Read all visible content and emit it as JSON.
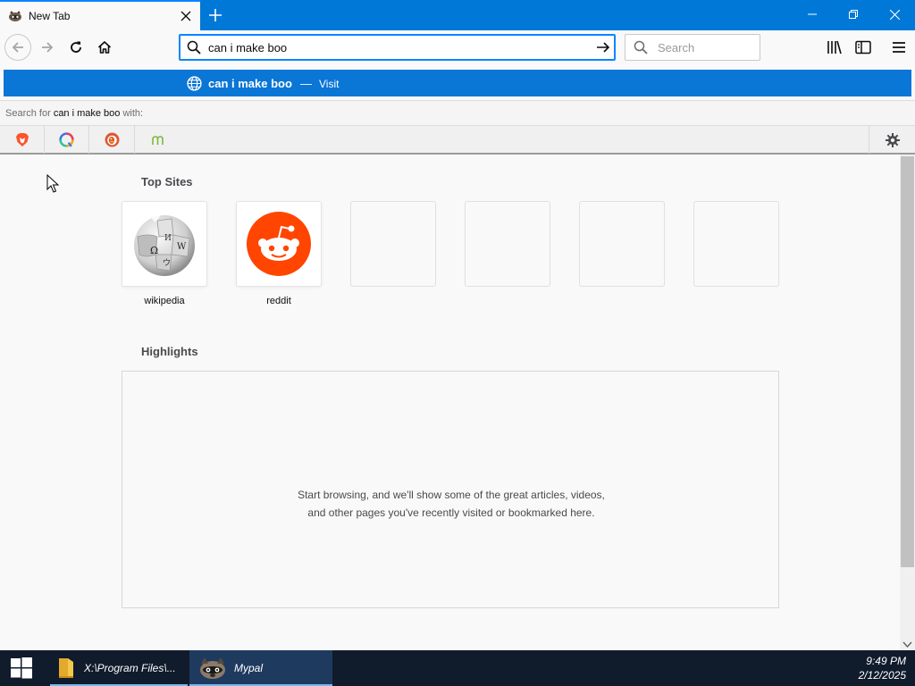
{
  "tab": {
    "title": "New Tab"
  },
  "urlbar": {
    "value": "can i make boo"
  },
  "searchbar": {
    "placeholder": "Search"
  },
  "autocomplete": {
    "result_title": "can i make boo",
    "separator": "—",
    "action": "Visit",
    "search_for_prefix": "Search for",
    "search_for_query": "can i make boo",
    "search_for_suffix": "with:",
    "engines": [
      "brave-icon",
      "qwant-icon",
      "duckduckgo-icon",
      "mojeek-icon"
    ]
  },
  "newtab": {
    "top_sites_title": "Top Sites",
    "top_sites": [
      {
        "label": "wikipedia",
        "icon": "wikipedia-icon"
      },
      {
        "label": "reddit",
        "icon": "reddit-icon"
      },
      {
        "label": ""
      },
      {
        "label": ""
      },
      {
        "label": ""
      },
      {
        "label": ""
      }
    ],
    "highlights_title": "Highlights",
    "highlights_message": "Start browsing, and we'll show some of the great articles, videos, and other pages you've recently visited or bookmarked here."
  },
  "taskbar": {
    "items": [
      {
        "label": "X:\\Program Files\\...",
        "icon": "folder-icon"
      },
      {
        "label": "Mypal",
        "icon": "mypal-icon"
      }
    ],
    "time": "9:49 PM",
    "date": "2/12/2025"
  },
  "colors": {
    "titlebar": "#0078d7",
    "accent": "#0a84ff",
    "autocomplete_selected": "#0a76d6",
    "reddit": "#ff4500",
    "taskbar": "#101b2c"
  }
}
